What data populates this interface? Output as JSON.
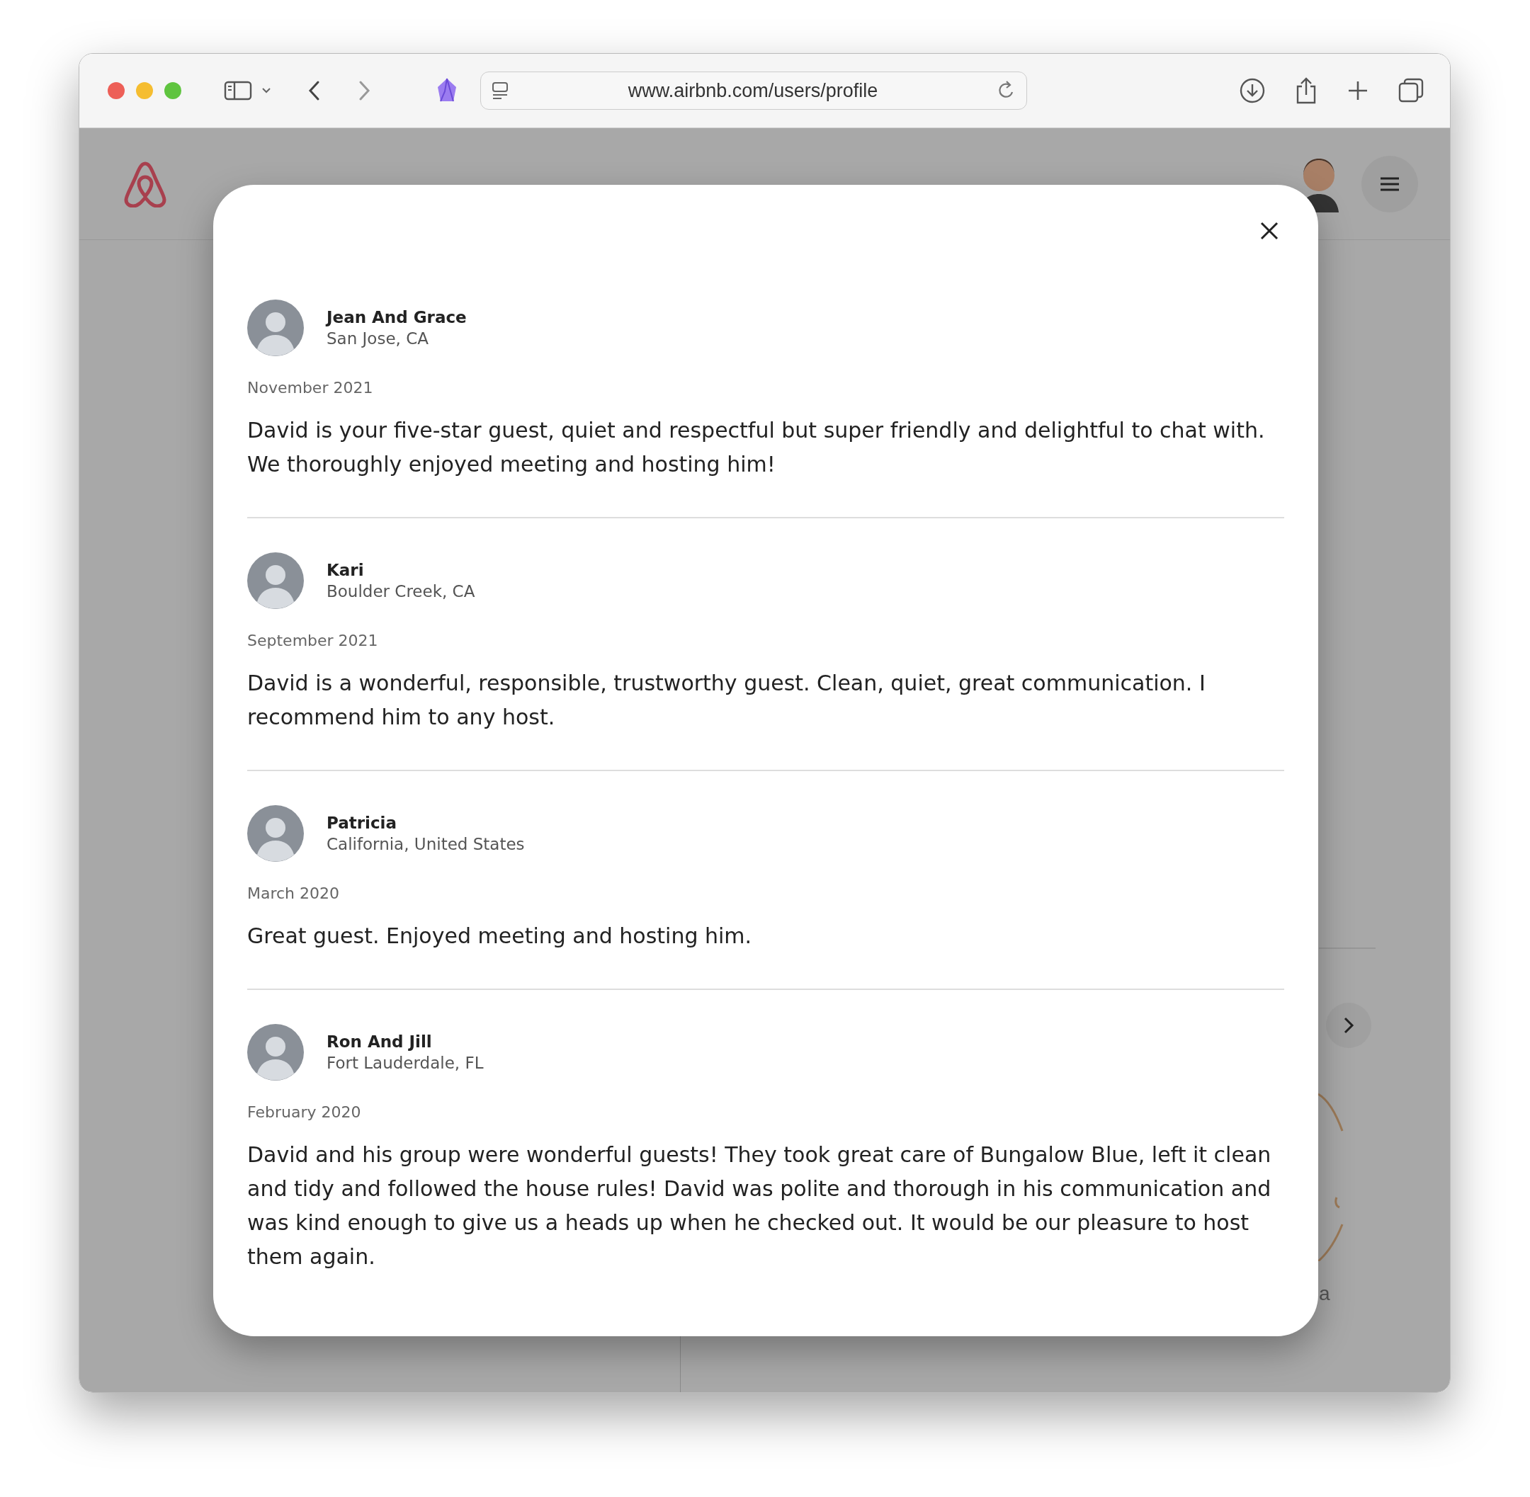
{
  "browser": {
    "url": "www.airbnb.com/users/profile"
  },
  "background": {
    "fragment": "a"
  },
  "reviews": [
    {
      "name": "Jean And Grace",
      "location": "San Jose, CA",
      "date": "November 2021",
      "text": "David is your five-star guest, quiet and respectful but super friendly and delightful to chat with.  We thoroughly enjoyed meeting and hosting him!"
    },
    {
      "name": "Kari",
      "location": "Boulder Creek, CA",
      "date": "September 2021",
      "text": "David is a wonderful, responsible, trustworthy guest. Clean, quiet, great communication. I recommend him to any host."
    },
    {
      "name": "Patricia",
      "location": "California, United States",
      "date": "March 2020",
      "text": "Great guest. Enjoyed meeting and hosting him."
    },
    {
      "name": "Ron And Jill",
      "location": "Fort Lauderdale, FL",
      "date": "February 2020",
      "text": "David and his group were wonderful guests! They took great care of Bungalow Blue, left it clean and tidy and followed the house rules!  David was polite and thorough in his communication and was kind enough to give us a heads up when he checked out.  It would be our pleasure to host them again."
    }
  ]
}
